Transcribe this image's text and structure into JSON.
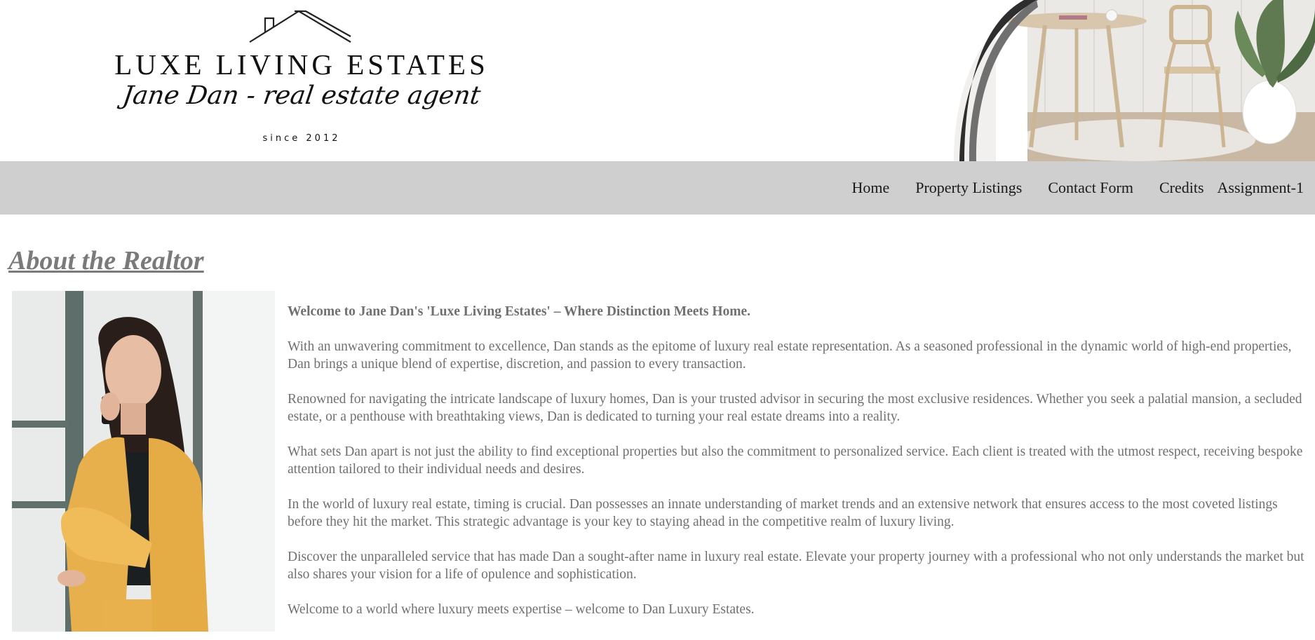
{
  "brand": {
    "name": "LUXE LIVING ESTATES",
    "tagline": "Jane Dan - real estate agent",
    "since": "since 2012"
  },
  "nav": {
    "items": [
      "Home",
      "Property Listings",
      "Contact Form",
      "Credits",
      "Assignment-1"
    ]
  },
  "about": {
    "title": "About the Realtor",
    "lead": "Welcome to Jane Dan's 'Luxe Living Estates' – Where Distinction Meets Home.",
    "paragraphs": [
      "With an unwavering commitment to excellence, Dan stands as the epitome of luxury real estate representation. As a seasoned professional in the dynamic world of high-end properties, Dan brings a unique blend of expertise, discretion, and passion to every transaction.",
      "Renowned for navigating the intricate landscape of luxury homes, Dan is your trusted advisor in securing the most exclusive residences. Whether you seek a palatial mansion, a secluded estate, or a penthouse with breathtaking views, Dan is dedicated to turning your real estate dreams into a reality.",
      "What sets Dan apart is not just the ability to find exceptional properties but also the commitment to personalized service. Each client is treated with the utmost respect, receiving bespoke attention tailored to their individual needs and desires.",
      "In the world of luxury real estate, timing is crucial. Dan possesses an innate understanding of market trends and an extensive network that ensures access to the most coveted listings before they hit the market. This strategic advantage is your key to staying ahead in the competitive realm of luxury living.",
      "Discover the unparalleled service that has made Dan a sought-after name in luxury real estate. Elevate your property journey with a professional who not only understands the market but also shares your vision for a life of opulence and sophistication.",
      "Welcome to a world where luxury meets expertise – welcome to Dan Luxury Estates."
    ]
  },
  "colors": {
    "nav_bg": "#cfcfcf",
    "heading": "#7a7a7a",
    "body_text": "#707070",
    "accent_jacket": "#e8b04c"
  },
  "icons": {
    "logo_mark": "house-roof-icon"
  }
}
